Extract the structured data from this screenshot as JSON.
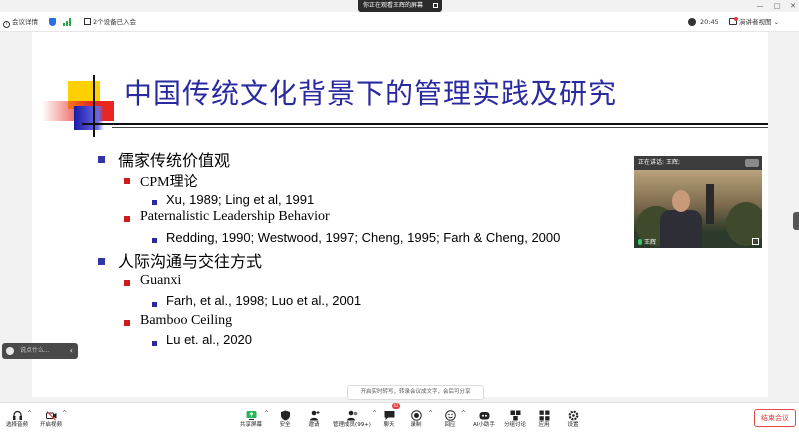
{
  "titlebar": {
    "share_status": "你正在观看王辉的屏幕"
  },
  "infobar": {
    "meeting_info": "会议详情",
    "devices": "2个设备已入会",
    "time": "20:45",
    "view_mode": "演讲者视图"
  },
  "slide": {
    "title": "中国传统文化背景下的管理实践及研究",
    "sections": [
      {
        "heading": "儒家传统价值观",
        "items": [
          {
            "heading": "CPM理论",
            "refs": [
              "Xu, 1989;  Ling et al, 1991"
            ]
          },
          {
            "heading": "Paternalistic Leadership Behavior",
            "refs": [
              "Redding, 1990; Westwood, 1997; Cheng, 1995;  Farh & Cheng, 2000"
            ]
          }
        ]
      },
      {
        "heading": "人际沟通与交往方式",
        "items": [
          {
            "heading": "Guanxi",
            "refs": [
              "Farh, et al., 1998; Luo et al., 2001"
            ]
          },
          {
            "heading": "Bamboo Ceiling",
            "refs": [
              "Lu et. al., 2020"
            ]
          }
        ]
      }
    ]
  },
  "video": {
    "speaking_label": "正在讲话:",
    "speaking_name": "王辉;",
    "participant_name": "王辉"
  },
  "chat": {
    "placeholder": "说点什么..."
  },
  "caption_tip": "开启实时转写，转录会议成文字，会后可分享",
  "toolbar": {
    "audio": "选择音频",
    "video": "开启视频",
    "share": "共享屏幕",
    "security": "安全",
    "invite": "邀请",
    "members": "管理成员(99+)",
    "chat": "聊天",
    "chat_badge": "42",
    "record": "录制",
    "reactions": "回应",
    "ai": "AI小助手",
    "breakout": "分组讨论",
    "apps": "应用",
    "settings": "设置",
    "end": "结束会议"
  },
  "colors": {
    "title_blue": "#2a2aa0",
    "accent_red": "#e23b3b",
    "deco_yellow": "#ffd000"
  }
}
